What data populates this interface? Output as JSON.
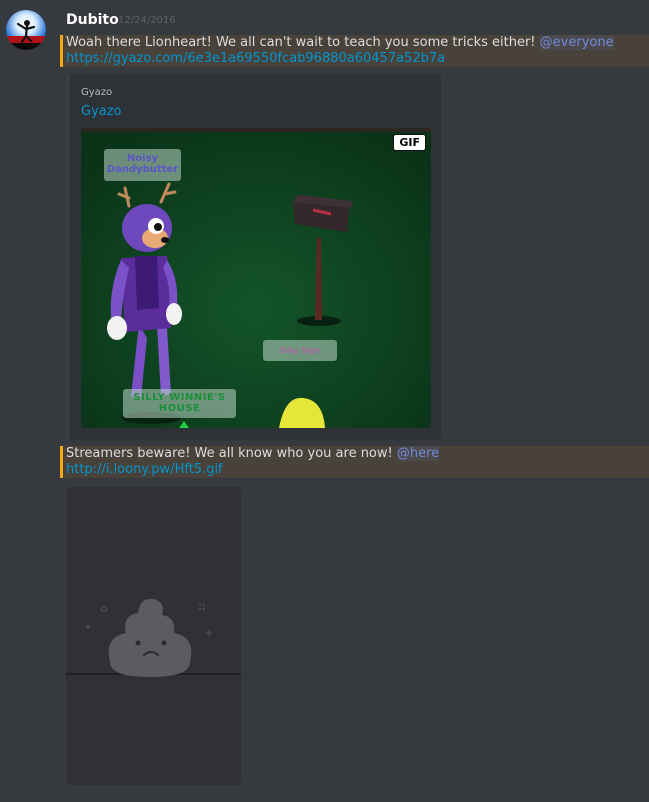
{
  "author": {
    "name": "Dubito",
    "timestamp": "12/24/2016",
    "avatar_icon": "user-avatar"
  },
  "messages": [
    {
      "text": "Woah there Lionheart! We all can't wait to teach you some tricks either!",
      "mention": "@everyone",
      "link": "https://gyazo.com/6e3e1a69550fcab96880a60457a52b7a"
    },
    {
      "text": "Streamers beware! We all know who you are now!",
      "mention": "@here",
      "link": "http://i.loony.pw/Hft5.gif"
    }
  ],
  "embed": {
    "provider": "Gyazo",
    "title": "Gyazo",
    "badge": "GIF",
    "signs": {
      "noisy": "Noisy Dandybutter",
      "middle": "Silly Sign",
      "house": "SILLY WINNIE'S HOUSE"
    }
  },
  "colors": {
    "background": "#36393e",
    "highlight_border": "#faa61a",
    "link": "#0096cf",
    "mention": "#7289da"
  }
}
